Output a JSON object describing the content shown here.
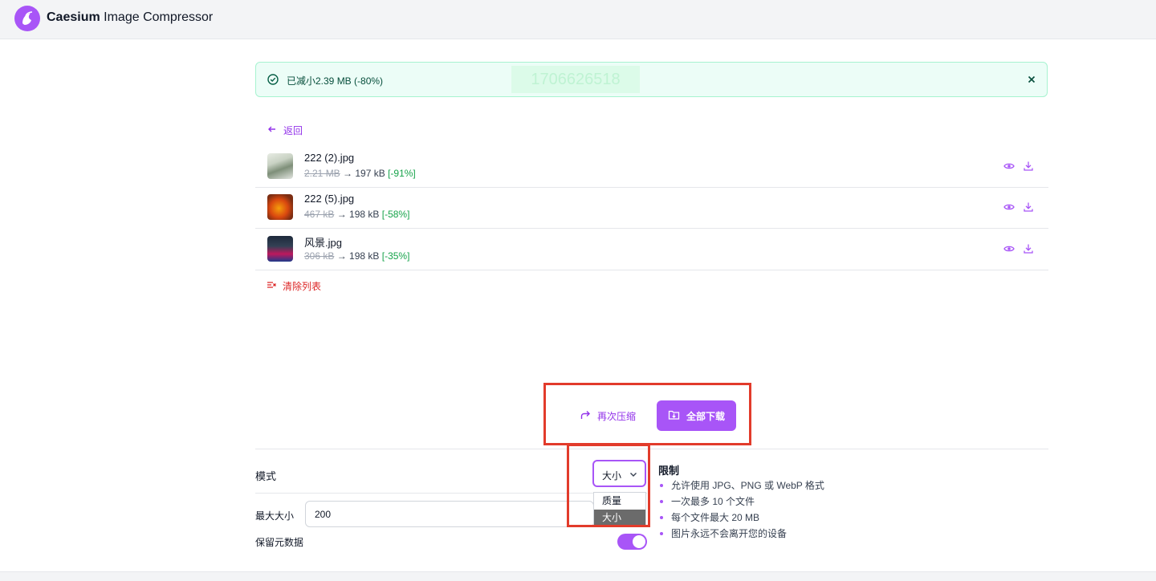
{
  "app": {
    "brand": "Caesium",
    "title_rest": " Image Compressor"
  },
  "alert": {
    "message": "已减小2.39 MB (-80%)",
    "ghost_text": "1706626518"
  },
  "nav": {
    "back_label": "返回"
  },
  "files": [
    {
      "name": "222 (2).jpg",
      "original": "2.21 MB",
      "arrow": " → ",
      "compressed": "197 kB",
      "percent": "[-91%]"
    },
    {
      "name": "222 (5).jpg",
      "original": "467 kB",
      "arrow": " → ",
      "compressed": "198 kB",
      "percent": "[-58%]"
    },
    {
      "name": "风景.jpg",
      "original": "306 kB",
      "arrow": " → ",
      "compressed": "198 kB",
      "percent": "[-35%]"
    }
  ],
  "actions": {
    "clear_label": "清除列表",
    "recompress_label": "再次压缩",
    "download_all_label": "全部下载"
  },
  "settings": {
    "mode_label": "模式",
    "mode_value": "大小",
    "mode_options": [
      "质量",
      "大小"
    ],
    "max_size_label": "最大大小",
    "max_size_value": "200",
    "keep_metadata_label": "保留元数据",
    "keep_metadata_on": true
  },
  "limits": {
    "title": "限制",
    "items": [
      "允许使用 JPG、PNG 或 WebP 格式",
      "一次最多 10 个文件",
      "每个文件最大 20 MB",
      "图片永远不会离开您的设备"
    ]
  },
  "colors": {
    "accent": "#a855f7",
    "success": "#16a34a",
    "danger": "#dc2626",
    "annotation": "#e23b2b"
  }
}
